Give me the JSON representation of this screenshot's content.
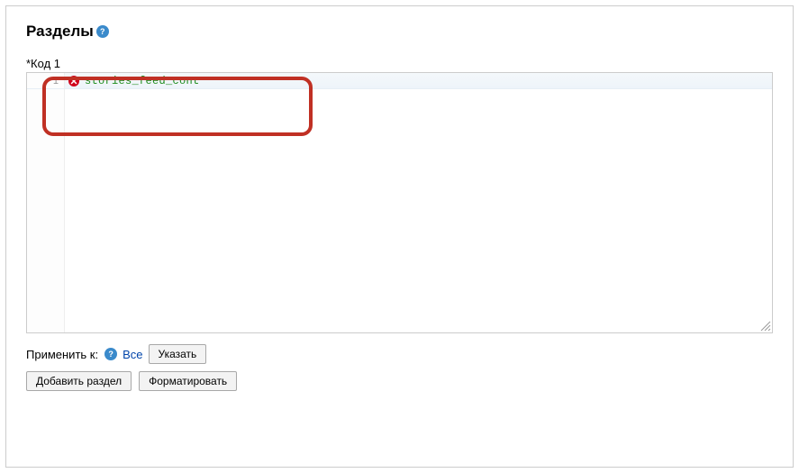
{
  "section": {
    "title": "Разделы"
  },
  "code": {
    "label": "*Код 1",
    "line_number": "1",
    "content": "stories_feed_cont"
  },
  "apply": {
    "label": "Применить к:",
    "all_link": "Все",
    "specify_button": "Указать"
  },
  "buttons": {
    "add_section": "Добавить раздел",
    "format": "Форматировать"
  }
}
